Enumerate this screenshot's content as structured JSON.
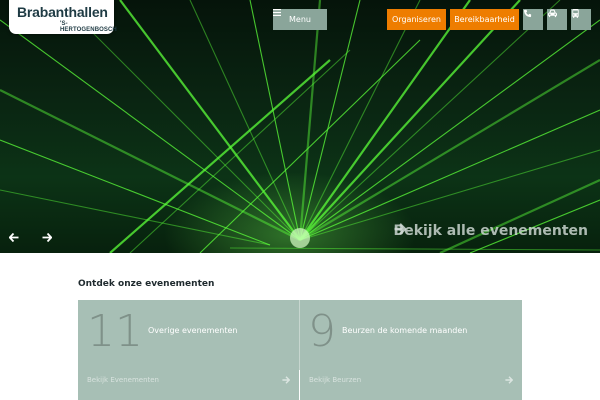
{
  "logo": {
    "name": "Brabanthallen",
    "city": "'S-HERTOGENBOSCH"
  },
  "header": {
    "menu_label": "Menu",
    "organiseren_label": "Organiseren",
    "bereikbaarheid_label": "Bereikbaarheid",
    "icons": [
      "phone-icon",
      "car-icon",
      "bus-icon"
    ]
  },
  "hero": {
    "all_events_label": "Bekijk alle evenementen",
    "nav_icons": [
      "arrow-left-icon",
      "arrow-right-icon"
    ]
  },
  "section": {
    "title": "Ontdek onze evenementen",
    "cards": [
      {
        "count": "11",
        "label": "Overige evenementen",
        "link": "Bekijk Evenementen"
      },
      {
        "count": "9",
        "label": "Beurzen de komende maanden",
        "link": "Bekijk Beurzen"
      }
    ]
  },
  "colors": {
    "orange": "#ee7d00",
    "sage": "#8aa59a",
    "card": "#a7bfb5",
    "laser": "#5cff3a"
  }
}
